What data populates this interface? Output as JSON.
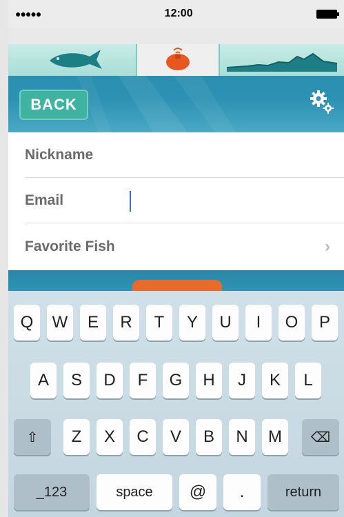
{
  "status_bar": {
    "signal": "●●●●●",
    "time": "12:00"
  },
  "tabs": [
    {
      "name": "fish",
      "icon": "fish-icon"
    },
    {
      "name": "buoy",
      "icon": "sonar-buoy-icon"
    },
    {
      "name": "terrain",
      "icon": "terrain-icon"
    }
  ],
  "header": {
    "back_label": "BACK",
    "settings_icon": "gear-icon"
  },
  "form": {
    "nickname_label": "Nickname",
    "email_label": "Email",
    "favorite_fish_label": "Favorite Fish",
    "chevron": "›"
  },
  "keyboard": {
    "row1": [
      "Q",
      "W",
      "E",
      "R",
      "T",
      "Y",
      "U",
      "I",
      "O",
      "P"
    ],
    "row2": [
      "A",
      "S",
      "D",
      "F",
      "G",
      "H",
      "J",
      "K",
      "L"
    ],
    "row3": [
      "Z",
      "X",
      "C",
      "V",
      "B",
      "N",
      "M"
    ],
    "shift": "⇧",
    "delete": "⌫",
    "num": "_123",
    "space": "space",
    "at": "@",
    "dot": ".",
    "return": "return"
  },
  "colors": {
    "accent_teal": "#3fb3a0",
    "water_blue": "#2b8fb0",
    "buoy_orange": "#e8571f"
  }
}
